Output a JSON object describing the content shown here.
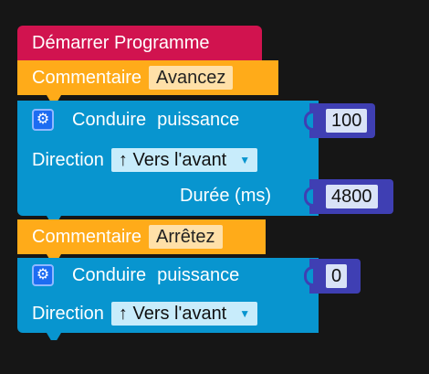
{
  "start_block": {
    "label": "Démarrer Programme"
  },
  "comment1": {
    "label": "Commentaire",
    "value": "Avancez"
  },
  "drive1": {
    "label": "Conduire",
    "power_label": "puissance",
    "power_value": "100",
    "direction_label": "Direction",
    "direction_value": "↑ Vers l'avant",
    "duration_label": "Durée (ms)",
    "duration_value": "4800"
  },
  "comment2": {
    "label": "Commentaire",
    "value": "Arrêtez"
  },
  "drive2": {
    "label": "Conduire",
    "power_label": "puissance",
    "power_value": "0",
    "direction_label": "Direction",
    "direction_value": "↑ Vers l'avant"
  },
  "icons": {
    "settings": "gear-icon",
    "dropdown": "triangle-down-icon"
  },
  "colors": {
    "start": "#d1134f",
    "comment": "#ffab19",
    "drive": "#0895cf",
    "socket": "#3f3fb3",
    "background": "#161616"
  }
}
